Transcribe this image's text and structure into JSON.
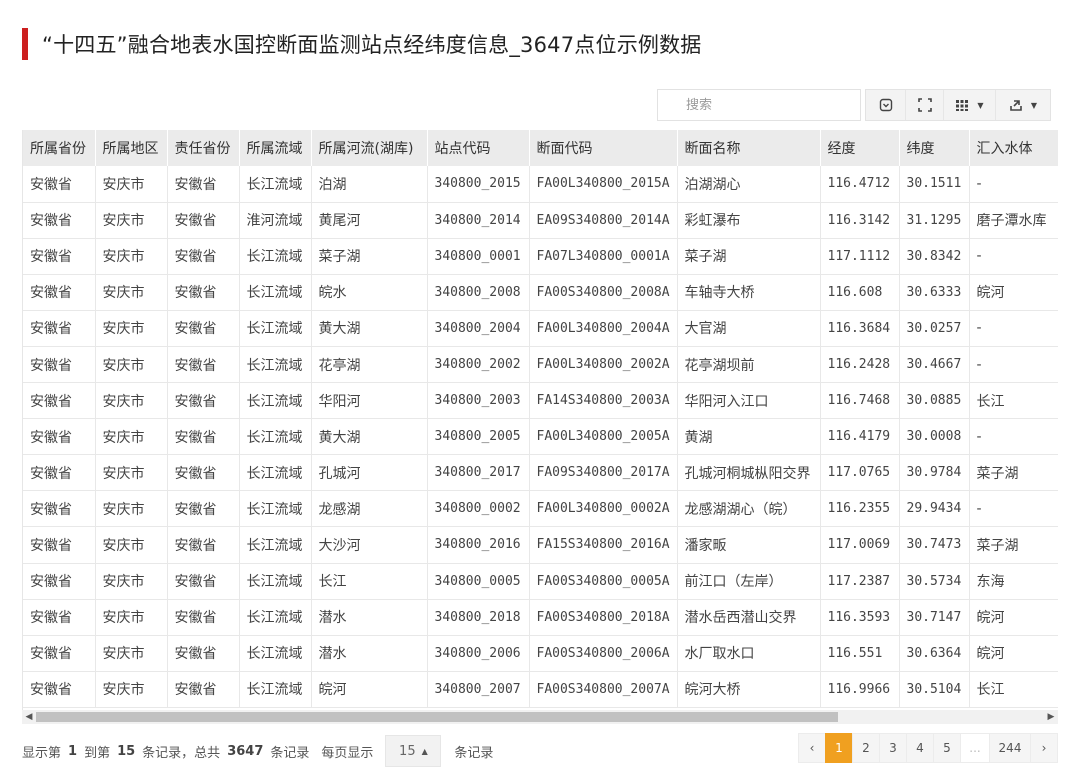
{
  "title": "“十四五”融合地表水国控断面监测站点经纬度信息_3647点位示例数据",
  "search": {
    "placeholder": "搜索"
  },
  "toolbar": {
    "icons": [
      "toggle-icon",
      "fullscreen-icon",
      "columns-icon",
      "export-icon"
    ]
  },
  "columns": [
    "所属省份",
    "所属地区",
    "责任省份",
    "所属流域",
    "所属河流(湖库)",
    "站点代码",
    "断面代码",
    "断面名称",
    "经度",
    "纬度",
    "汇入水体"
  ],
  "rows": [
    [
      "安徽省",
      "安庆市",
      "安徽省",
      "长江流域",
      "泊湖",
      "340800_2015",
      "FA00L340800_2015A",
      "泊湖湖心",
      "116.4712",
      "30.1511",
      "-"
    ],
    [
      "安徽省",
      "安庆市",
      "安徽省",
      "淮河流域",
      "黄尾河",
      "340800_2014",
      "EA09S340800_2014A",
      "彩虹瀑布",
      "116.3142",
      "31.1295",
      "磨子潭水库"
    ],
    [
      "安徽省",
      "安庆市",
      "安徽省",
      "长江流域",
      "菜子湖",
      "340800_0001",
      "FA07L340800_0001A",
      "菜子湖",
      "117.1112",
      "30.8342",
      "-"
    ],
    [
      "安徽省",
      "安庆市",
      "安徽省",
      "长江流域",
      "皖水",
      "340800_2008",
      "FA00S340800_2008A",
      "车轴寺大桥",
      "116.608",
      "30.6333",
      "皖河"
    ],
    [
      "安徽省",
      "安庆市",
      "安徽省",
      "长江流域",
      "黄大湖",
      "340800_2004",
      "FA00L340800_2004A",
      "大官湖",
      "116.3684",
      "30.0257",
      "-"
    ],
    [
      "安徽省",
      "安庆市",
      "安徽省",
      "长江流域",
      "花亭湖",
      "340800_2002",
      "FA00L340800_2002A",
      "花亭湖坝前",
      "116.2428",
      "30.4667",
      "-"
    ],
    [
      "安徽省",
      "安庆市",
      "安徽省",
      "长江流域",
      "华阳河",
      "340800_2003",
      "FA14S340800_2003A",
      "华阳河入江口",
      "116.7468",
      "30.0885",
      "长江"
    ],
    [
      "安徽省",
      "安庆市",
      "安徽省",
      "长江流域",
      "黄大湖",
      "340800_2005",
      "FA00L340800_2005A",
      "黄湖",
      "116.4179",
      "30.0008",
      "-"
    ],
    [
      "安徽省",
      "安庆市",
      "安徽省",
      "长江流域",
      "孔城河",
      "340800_2017",
      "FA09S340800_2017A",
      "孔城河桐城枞阳交界",
      "117.0765",
      "30.9784",
      "菜子湖"
    ],
    [
      "安徽省",
      "安庆市",
      "安徽省",
      "长江流域",
      "龙感湖",
      "340800_0002",
      "FA00L340800_0002A",
      "龙感湖湖心（皖）",
      "116.2355",
      "29.9434",
      "-"
    ],
    [
      "安徽省",
      "安庆市",
      "安徽省",
      "长江流域",
      "大沙河",
      "340800_2016",
      "FA15S340800_2016A",
      "潘家畈",
      "117.0069",
      "30.7473",
      "菜子湖"
    ],
    [
      "安徽省",
      "安庆市",
      "安徽省",
      "长江流域",
      "长江",
      "340800_0005",
      "FA00S340800_0005A",
      "前江口（左岸）",
      "117.2387",
      "30.5734",
      "东海"
    ],
    [
      "安徽省",
      "安庆市",
      "安徽省",
      "长江流域",
      "潜水",
      "340800_2018",
      "FA00S340800_2018A",
      "潜水岳西潜山交界",
      "116.3593",
      "30.7147",
      "皖河"
    ],
    [
      "安徽省",
      "安庆市",
      "安徽省",
      "长江流域",
      "潜水",
      "340800_2006",
      "FA00S340800_2006A",
      "水厂取水口",
      "116.551",
      "30.6364",
      "皖河"
    ],
    [
      "安徽省",
      "安庆市",
      "安徽省",
      "长江流域",
      "皖河",
      "340800_2007",
      "FA00S340800_2007A",
      "皖河大桥",
      "116.9966",
      "30.5104",
      "长江"
    ]
  ],
  "footer": {
    "text_show": "显示第",
    "from": "1",
    "text_to": "到第",
    "to": "15",
    "text_total": "条记录，总共",
    "total": "3647",
    "text_records": "条记录",
    "text_per_page": "每页显示",
    "per_page": "15",
    "text_records2": "条记录"
  },
  "pagination": {
    "prev": "‹",
    "pages": [
      "1",
      "2",
      "3",
      "4",
      "5"
    ],
    "active": "1",
    "ellipsis": "...",
    "last": "244",
    "next": "›"
  },
  "colors": {
    "accent": "#cc1f1f",
    "active_page": "#f0a020"
  }
}
